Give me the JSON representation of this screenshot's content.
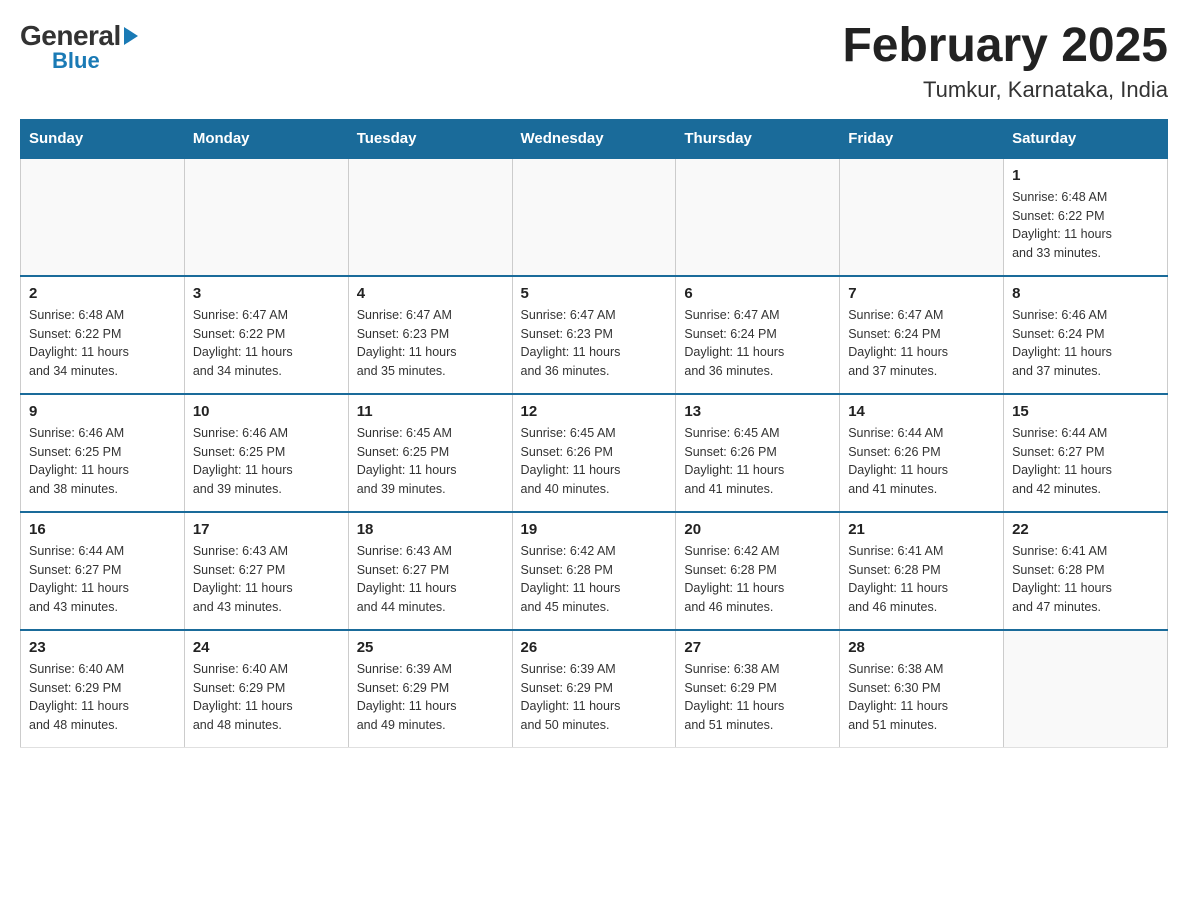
{
  "logo": {
    "general": "General",
    "blue": "Blue"
  },
  "title": "February 2025",
  "subtitle": "Tumkur, Karnataka, India",
  "weekdays": [
    "Sunday",
    "Monday",
    "Tuesday",
    "Wednesday",
    "Thursday",
    "Friday",
    "Saturday"
  ],
  "weeks": [
    [
      {
        "day": "",
        "info": ""
      },
      {
        "day": "",
        "info": ""
      },
      {
        "day": "",
        "info": ""
      },
      {
        "day": "",
        "info": ""
      },
      {
        "day": "",
        "info": ""
      },
      {
        "day": "",
        "info": ""
      },
      {
        "day": "1",
        "info": "Sunrise: 6:48 AM\nSunset: 6:22 PM\nDaylight: 11 hours\nand 33 minutes."
      }
    ],
    [
      {
        "day": "2",
        "info": "Sunrise: 6:48 AM\nSunset: 6:22 PM\nDaylight: 11 hours\nand 34 minutes."
      },
      {
        "day": "3",
        "info": "Sunrise: 6:47 AM\nSunset: 6:22 PM\nDaylight: 11 hours\nand 34 minutes."
      },
      {
        "day": "4",
        "info": "Sunrise: 6:47 AM\nSunset: 6:23 PM\nDaylight: 11 hours\nand 35 minutes."
      },
      {
        "day": "5",
        "info": "Sunrise: 6:47 AM\nSunset: 6:23 PM\nDaylight: 11 hours\nand 36 minutes."
      },
      {
        "day": "6",
        "info": "Sunrise: 6:47 AM\nSunset: 6:24 PM\nDaylight: 11 hours\nand 36 minutes."
      },
      {
        "day": "7",
        "info": "Sunrise: 6:47 AM\nSunset: 6:24 PM\nDaylight: 11 hours\nand 37 minutes."
      },
      {
        "day": "8",
        "info": "Sunrise: 6:46 AM\nSunset: 6:24 PM\nDaylight: 11 hours\nand 37 minutes."
      }
    ],
    [
      {
        "day": "9",
        "info": "Sunrise: 6:46 AM\nSunset: 6:25 PM\nDaylight: 11 hours\nand 38 minutes."
      },
      {
        "day": "10",
        "info": "Sunrise: 6:46 AM\nSunset: 6:25 PM\nDaylight: 11 hours\nand 39 minutes."
      },
      {
        "day": "11",
        "info": "Sunrise: 6:45 AM\nSunset: 6:25 PM\nDaylight: 11 hours\nand 39 minutes."
      },
      {
        "day": "12",
        "info": "Sunrise: 6:45 AM\nSunset: 6:26 PM\nDaylight: 11 hours\nand 40 minutes."
      },
      {
        "day": "13",
        "info": "Sunrise: 6:45 AM\nSunset: 6:26 PM\nDaylight: 11 hours\nand 41 minutes."
      },
      {
        "day": "14",
        "info": "Sunrise: 6:44 AM\nSunset: 6:26 PM\nDaylight: 11 hours\nand 41 minutes."
      },
      {
        "day": "15",
        "info": "Sunrise: 6:44 AM\nSunset: 6:27 PM\nDaylight: 11 hours\nand 42 minutes."
      }
    ],
    [
      {
        "day": "16",
        "info": "Sunrise: 6:44 AM\nSunset: 6:27 PM\nDaylight: 11 hours\nand 43 minutes."
      },
      {
        "day": "17",
        "info": "Sunrise: 6:43 AM\nSunset: 6:27 PM\nDaylight: 11 hours\nand 43 minutes."
      },
      {
        "day": "18",
        "info": "Sunrise: 6:43 AM\nSunset: 6:27 PM\nDaylight: 11 hours\nand 44 minutes."
      },
      {
        "day": "19",
        "info": "Sunrise: 6:42 AM\nSunset: 6:28 PM\nDaylight: 11 hours\nand 45 minutes."
      },
      {
        "day": "20",
        "info": "Sunrise: 6:42 AM\nSunset: 6:28 PM\nDaylight: 11 hours\nand 46 minutes."
      },
      {
        "day": "21",
        "info": "Sunrise: 6:41 AM\nSunset: 6:28 PM\nDaylight: 11 hours\nand 46 minutes."
      },
      {
        "day": "22",
        "info": "Sunrise: 6:41 AM\nSunset: 6:28 PM\nDaylight: 11 hours\nand 47 minutes."
      }
    ],
    [
      {
        "day": "23",
        "info": "Sunrise: 6:40 AM\nSunset: 6:29 PM\nDaylight: 11 hours\nand 48 minutes."
      },
      {
        "day": "24",
        "info": "Sunrise: 6:40 AM\nSunset: 6:29 PM\nDaylight: 11 hours\nand 48 minutes."
      },
      {
        "day": "25",
        "info": "Sunrise: 6:39 AM\nSunset: 6:29 PM\nDaylight: 11 hours\nand 49 minutes."
      },
      {
        "day": "26",
        "info": "Sunrise: 6:39 AM\nSunset: 6:29 PM\nDaylight: 11 hours\nand 50 minutes."
      },
      {
        "day": "27",
        "info": "Sunrise: 6:38 AM\nSunset: 6:29 PM\nDaylight: 11 hours\nand 51 minutes."
      },
      {
        "day": "28",
        "info": "Sunrise: 6:38 AM\nSunset: 6:30 PM\nDaylight: 11 hours\nand 51 minutes."
      },
      {
        "day": "",
        "info": ""
      }
    ]
  ]
}
